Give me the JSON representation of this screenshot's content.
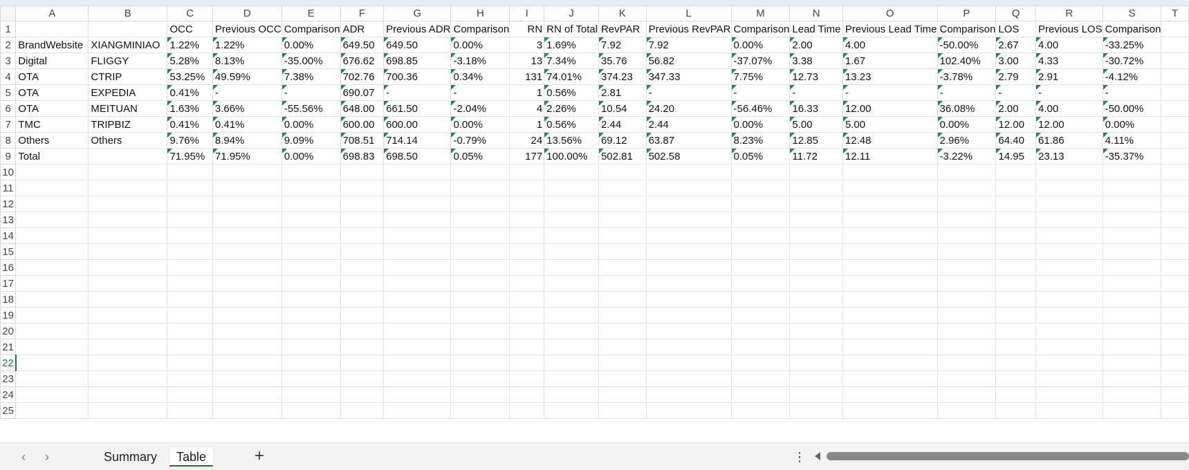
{
  "columns": [
    "A",
    "B",
    "C",
    "D",
    "E",
    "F",
    "G",
    "H",
    "I",
    "J",
    "K",
    "L",
    "M",
    "N",
    "O",
    "P",
    "Q",
    "R",
    "S",
    "T"
  ],
  "active_row": "22",
  "header_row": {
    "row": "1",
    "cells": [
      "",
      "",
      "OCC",
      "Previous OCC",
      "Comparison",
      "ADR",
      "Previous ADR",
      "Comparison",
      "RN",
      "RN of Total",
      "RevPAR",
      "Previous RevPAR",
      "Comparison",
      "Lead Time",
      "Previous Lead Time",
      "Comparison",
      "LOS",
      "Previous LOS",
      "Comparison",
      ""
    ]
  },
  "rows": [
    {
      "row": "2",
      "cells": [
        "BrandWebsite",
        "XIANGMINIAO",
        "1.22%",
        "1.22%",
        "0.00%",
        "649.50",
        "649.50",
        "0.00%",
        "3",
        "1.69%",
        "7.92",
        "7.92",
        "0.00%",
        "2.00",
        "4.00",
        "-50.00%",
        "2.67",
        "4.00",
        "-33.25%",
        ""
      ]
    },
    {
      "row": "3",
      "cells": [
        "Digital",
        "FLIGGY",
        "5.28%",
        "8.13%",
        "-35.00%",
        "676.62",
        "698.85",
        "-3.18%",
        "13",
        "7.34%",
        "35.76",
        "56.82",
        "-37.07%",
        "3.38",
        "1.67",
        "102.40%",
        "3.00",
        "4.33",
        "-30.72%",
        ""
      ]
    },
    {
      "row": "4",
      "cells": [
        "OTA",
        "CTRIP",
        "53.25%",
        "49.59%",
        "7.38%",
        "702.76",
        "700.36",
        "0.34%",
        "131",
        "74.01%",
        "374.23",
        "347.33",
        "7.75%",
        "12.73",
        "13.23",
        "-3.78%",
        "2.79",
        "2.91",
        "-4.12%",
        ""
      ]
    },
    {
      "row": "5",
      "cells": [
        "OTA",
        "EXPEDIA",
        "0.41%",
        "-",
        "-",
        "690.07",
        "-",
        "-",
        "1",
        "0.56%",
        "2.81",
        "-",
        "-",
        "-",
        "-",
        "-",
        "-",
        "-",
        "-",
        ""
      ]
    },
    {
      "row": "6",
      "cells": [
        "OTA",
        "MEITUAN",
        "1.63%",
        "3.66%",
        "-55.56%",
        "648.00",
        "661.50",
        "-2.04%",
        "4",
        "2.26%",
        "10.54",
        "24.20",
        "-56.46%",
        "16.33",
        "12.00",
        "36.08%",
        "2.00",
        "4.00",
        "-50.00%",
        ""
      ]
    },
    {
      "row": "7",
      "cells": [
        "TMC",
        "TRIPBIZ",
        "0.41%",
        "0.41%",
        "0.00%",
        "600.00",
        "600.00",
        "0.00%",
        "1",
        "0.56%",
        "2.44",
        "2.44",
        "0.00%",
        "5.00",
        "5.00",
        "0.00%",
        "12.00",
        "12.00",
        "0.00%",
        ""
      ]
    },
    {
      "row": "8",
      "cells": [
        "Others",
        "Others",
        "9.76%",
        "8.94%",
        "9.09%",
        "708.51",
        "714.14",
        "-0.79%",
        "24",
        "13.56%",
        "69.12",
        "63.87",
        "8.23%",
        "12.85",
        "12.48",
        "2.96%",
        "64.40",
        "61.86",
        "4.11%",
        ""
      ]
    },
    {
      "row": "9",
      "cells": [
        "Total",
        "",
        "71.95%",
        "71.95%",
        "0.00%",
        "698.83",
        "698.50",
        "0.05%",
        "177",
        "100.00%",
        "502.81",
        "502.58",
        "0.05%",
        "11.72",
        "12.11",
        "-3.22%",
        "14.95",
        "23.13",
        "-35.37%",
        ""
      ]
    }
  ],
  "empty_rows": [
    "10",
    "11",
    "12",
    "13",
    "14",
    "15",
    "16",
    "17",
    "18",
    "19",
    "20",
    "21",
    "22",
    "23",
    "24",
    "25"
  ],
  "tabs": [
    {
      "label": "Summary",
      "active": false
    },
    {
      "label": "Table",
      "active": true
    }
  ],
  "tab_nav": {
    "prev": "‹",
    "next": "›",
    "add": "+",
    "more": "⋮"
  },
  "colors": {
    "accent": "#217346",
    "number_marker": "#1e8a46"
  }
}
